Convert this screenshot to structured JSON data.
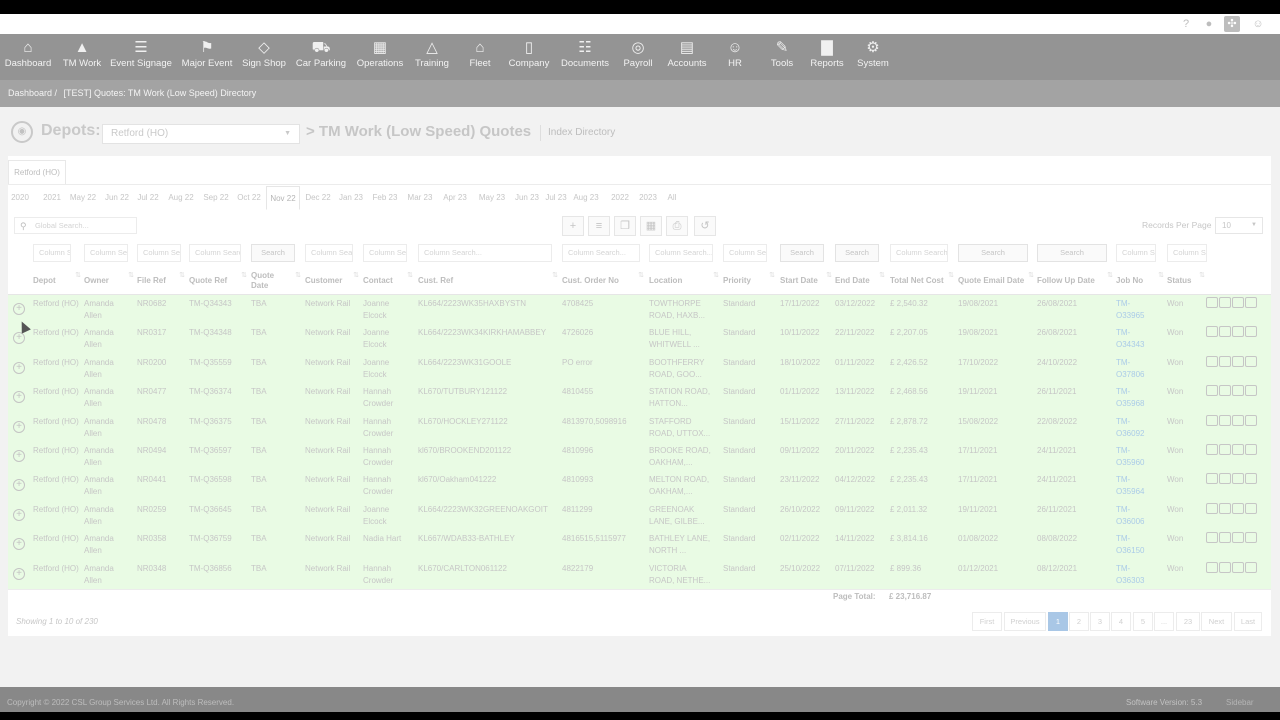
{
  "nav": {
    "items": [
      {
        "label": "Dashboard",
        "icon": "home-icon"
      },
      {
        "label": "TM Work",
        "icon": "cone-icon"
      },
      {
        "label": "Event Signage",
        "icon": "signage-icon"
      },
      {
        "label": "Major Event",
        "icon": "flag-icon"
      },
      {
        "label": "Sign Shop",
        "icon": "diamond-sign-icon"
      },
      {
        "label": "Car Parking",
        "icon": "car-icon"
      },
      {
        "label": "Operations",
        "icon": "calendar-icon"
      },
      {
        "label": "Training",
        "icon": "graduation-cap-icon"
      },
      {
        "label": "Fleet",
        "icon": "garage-icon"
      },
      {
        "label": "Company",
        "icon": "building-icon"
      },
      {
        "label": "Documents",
        "icon": "documents-icon"
      },
      {
        "label": "Payroll",
        "icon": "money-icon"
      },
      {
        "label": "Accounts",
        "icon": "calculator-icon"
      },
      {
        "label": "HR",
        "icon": "people-icon"
      },
      {
        "label": "Tools",
        "icon": "pencil-icon"
      },
      {
        "label": "Reports",
        "icon": "bar-chart-icon"
      },
      {
        "label": "System",
        "icon": "cogs-icon"
      }
    ]
  },
  "breadcrumb": {
    "home": "Dashboard /",
    "current": "[TEST] Quotes: TM Work (Low Speed) Directory"
  },
  "header": {
    "depots_label": "Depots:",
    "depot_selected": "Retford (HO)",
    "title": "> TM Work (Low Speed) Quotes",
    "subtitle": "Index Directory"
  },
  "depot_tab": "Retford (HO)",
  "periods": [
    "2020",
    "2021",
    "May 22",
    "Jun 22",
    "Jul 22",
    "Aug 22",
    "Sep 22",
    "Oct 22",
    "Nov 22",
    "Dec 22",
    "Jan 23",
    "Feb 23",
    "Mar 23",
    "Apr 23",
    "May 23",
    "Jun 23",
    "Jul 23",
    "Aug 23",
    "2022",
    "2023",
    "All"
  ],
  "selected_period": "Nov 22",
  "search": {
    "global_placeholder": "Global Search...",
    "column_placeholder": "Column Search...",
    "search_btn": "Search"
  },
  "records_per_page": {
    "label": "Records Per Page",
    "value": "10"
  },
  "columns": [
    "Depot",
    "Owner",
    "File Ref",
    "Quote Ref",
    "Quote Date",
    "Customer",
    "Contact",
    "Cust. Ref",
    "Cust. Order No",
    "Location",
    "Priority",
    "Start Date",
    "End Date",
    "Total Net Cost",
    "Quote Email Date",
    "Follow Up Date",
    "Job No",
    "Status"
  ],
  "rows": [
    {
      "depot": "Retford (HO)",
      "owner": "Amanda Allen",
      "file_ref": "NR0682",
      "quote_ref": "TM-Q34343",
      "quote_date": "TBA",
      "customer": "Network Rail",
      "contact": "Joanne Elcock",
      "cust_ref": "KL664/2223WK35HAXBYSTN",
      "order_no": "4708425",
      "location": "TOWTHORPE ROAD, HAXB...",
      "priority": "Standard",
      "start": "17/11/2022",
      "end": "03/12/2022",
      "cost": "£ 2,540.32",
      "email_date": "19/08/2021",
      "follow_up": "26/08/2021",
      "job_no": "TM-O33965",
      "status": "Won"
    },
    {
      "depot": "Retford (HO)",
      "owner": "Amanda Allen",
      "file_ref": "NR0317",
      "quote_ref": "TM-Q34348",
      "quote_date": "TBA",
      "customer": "Network Rail",
      "contact": "Joanne Elcock",
      "cust_ref": "KL664/2223WK34KIRKHAMABBEY",
      "order_no": "4726026",
      "location": "BLUE HILL, WHITWELL ...",
      "priority": "Standard",
      "start": "10/11/2022",
      "end": "22/11/2022",
      "cost": "£ 2,207.05",
      "email_date": "19/08/2021",
      "follow_up": "26/08/2021",
      "job_no": "TM-O34343",
      "status": "Won"
    },
    {
      "depot": "Retford (HO)",
      "owner": "Amanda Allen",
      "file_ref": "NR0200",
      "quote_ref": "TM-Q35559",
      "quote_date": "TBA",
      "customer": "Network Rail",
      "contact": "Joanne Elcock",
      "cust_ref": "KL664/2223WK31GOOLE",
      "order_no": "PO error",
      "location": "BOOTHFERRY ROAD, GOO...",
      "priority": "Standard",
      "start": "18/10/2022",
      "end": "01/11/2022",
      "cost": "£ 2,426.52",
      "email_date": "17/10/2022",
      "follow_up": "24/10/2022",
      "job_no": "TM-O37806",
      "status": "Won"
    },
    {
      "depot": "Retford (HO)",
      "owner": "Amanda Allen",
      "file_ref": "NR0477",
      "quote_ref": "TM-Q36374",
      "quote_date": "TBA",
      "customer": "Network Rail",
      "contact": "Hannah Crowder",
      "cust_ref": "KL670/TUTBURY121122",
      "order_no": "4810455",
      "location": "STATION ROAD, HATTON...",
      "priority": "Standard",
      "start": "01/11/2022",
      "end": "13/11/2022",
      "cost": "£ 2,468.56",
      "email_date": "19/11/2021",
      "follow_up": "26/11/2021",
      "job_no": "TM-O35968",
      "status": "Won"
    },
    {
      "depot": "Retford (HO)",
      "owner": "Amanda Allen",
      "file_ref": "NR0478",
      "quote_ref": "TM-Q36375",
      "quote_date": "TBA",
      "customer": "Network Rail",
      "contact": "Hannah Crowder",
      "cust_ref": "KL670/HOCKLEY271122",
      "order_no": "4813970,5098916",
      "location": "STAFFORD ROAD, UTTOX...",
      "priority": "Standard",
      "start": "15/11/2022",
      "end": "27/11/2022",
      "cost": "£ 2,878.72",
      "email_date": "15/08/2022",
      "follow_up": "22/08/2022",
      "job_no": "TM-O36092",
      "status": "Won"
    },
    {
      "depot": "Retford (HO)",
      "owner": "Amanda Allen",
      "file_ref": "NR0494",
      "quote_ref": "TM-Q36597",
      "quote_date": "TBA",
      "customer": "Network Rail",
      "contact": "Hannah Crowder",
      "cust_ref": "kl670/BROOKEND201122",
      "order_no": "4810996",
      "location": "BROOKE ROAD, OAKHAM,...",
      "priority": "Standard",
      "start": "09/11/2022",
      "end": "20/11/2022",
      "cost": "£ 2,235.43",
      "email_date": "17/11/2021",
      "follow_up": "24/11/2021",
      "job_no": "TM-O35960",
      "status": "Won"
    },
    {
      "depot": "Retford (HO)",
      "owner": "Amanda Allen",
      "file_ref": "NR0441",
      "quote_ref": "TM-Q36598",
      "quote_date": "TBA",
      "customer": "Network Rail",
      "contact": "Hannah Crowder",
      "cust_ref": "kl670/Oakham041222",
      "order_no": "4810993",
      "location": "MELTON ROAD, OAKHAM,...",
      "priority": "Standard",
      "start": "23/11/2022",
      "end": "04/12/2022",
      "cost": "£ 2,235.43",
      "email_date": "17/11/2021",
      "follow_up": "24/11/2021",
      "job_no": "TM-O35964",
      "status": "Won"
    },
    {
      "depot": "Retford (HO)",
      "owner": "Amanda Allen",
      "file_ref": "NR0259",
      "quote_ref": "TM-Q36645",
      "quote_date": "TBA",
      "customer": "Network Rail",
      "contact": "Joanne Elcock",
      "cust_ref": "KL664/2223WK32GREENOAKGOIT",
      "order_no": "4811299",
      "location": "GREENOAK LANE, GILBE...",
      "priority": "Standard",
      "start": "26/10/2022",
      "end": "09/11/2022",
      "cost": "£ 2,011.32",
      "email_date": "19/11/2021",
      "follow_up": "26/11/2021",
      "job_no": "TM-O36006",
      "status": "Won"
    },
    {
      "depot": "Retford (HO)",
      "owner": "Amanda Allen",
      "file_ref": "NR0358",
      "quote_ref": "TM-Q36759",
      "quote_date": "TBA",
      "customer": "Network Rail",
      "contact": "Nadia Hart",
      "cust_ref": "KL667/WDAB33-BATHLEY",
      "order_no": "4816515,5115977",
      "location": "BATHLEY LANE, NORTH ...",
      "priority": "Standard",
      "start": "02/11/2022",
      "end": "14/11/2022",
      "cost": "£ 3,814.16",
      "email_date": "01/08/2022",
      "follow_up": "08/08/2022",
      "job_no": "TM-O36150",
      "status": "Won"
    },
    {
      "depot": "Retford (HO)",
      "owner": "Amanda Allen",
      "file_ref": "NR0348",
      "quote_ref": "TM-Q36856",
      "quote_date": "TBA",
      "customer": "Network Rail",
      "contact": "Hannah Crowder",
      "cust_ref": "KL670/CARLTON061122",
      "order_no": "4822179",
      "location": "VICTORIA ROAD, NETHE...",
      "priority": "Standard",
      "start": "25/10/2022",
      "end": "07/11/2022",
      "cost": "£ 899.36",
      "email_date": "01/12/2021",
      "follow_up": "08/12/2021",
      "job_no": "TM-O36303",
      "status": "Won"
    }
  ],
  "page_total": {
    "label": "Page Total:",
    "value": "£ 23,716.87"
  },
  "showing": "Showing 1 to 10 of 230",
  "pagination": [
    "First",
    "Previous",
    "1",
    "2",
    "3",
    "4",
    "5",
    "...",
    "23",
    "Next",
    "Last"
  ],
  "pagination_current": "1",
  "footer": {
    "copyright": "Copyright © 2022 CSL Group Services Ltd. All Rights Reserved.",
    "version": "Software Version: 5.3",
    "sidebar": "Sidebar"
  }
}
